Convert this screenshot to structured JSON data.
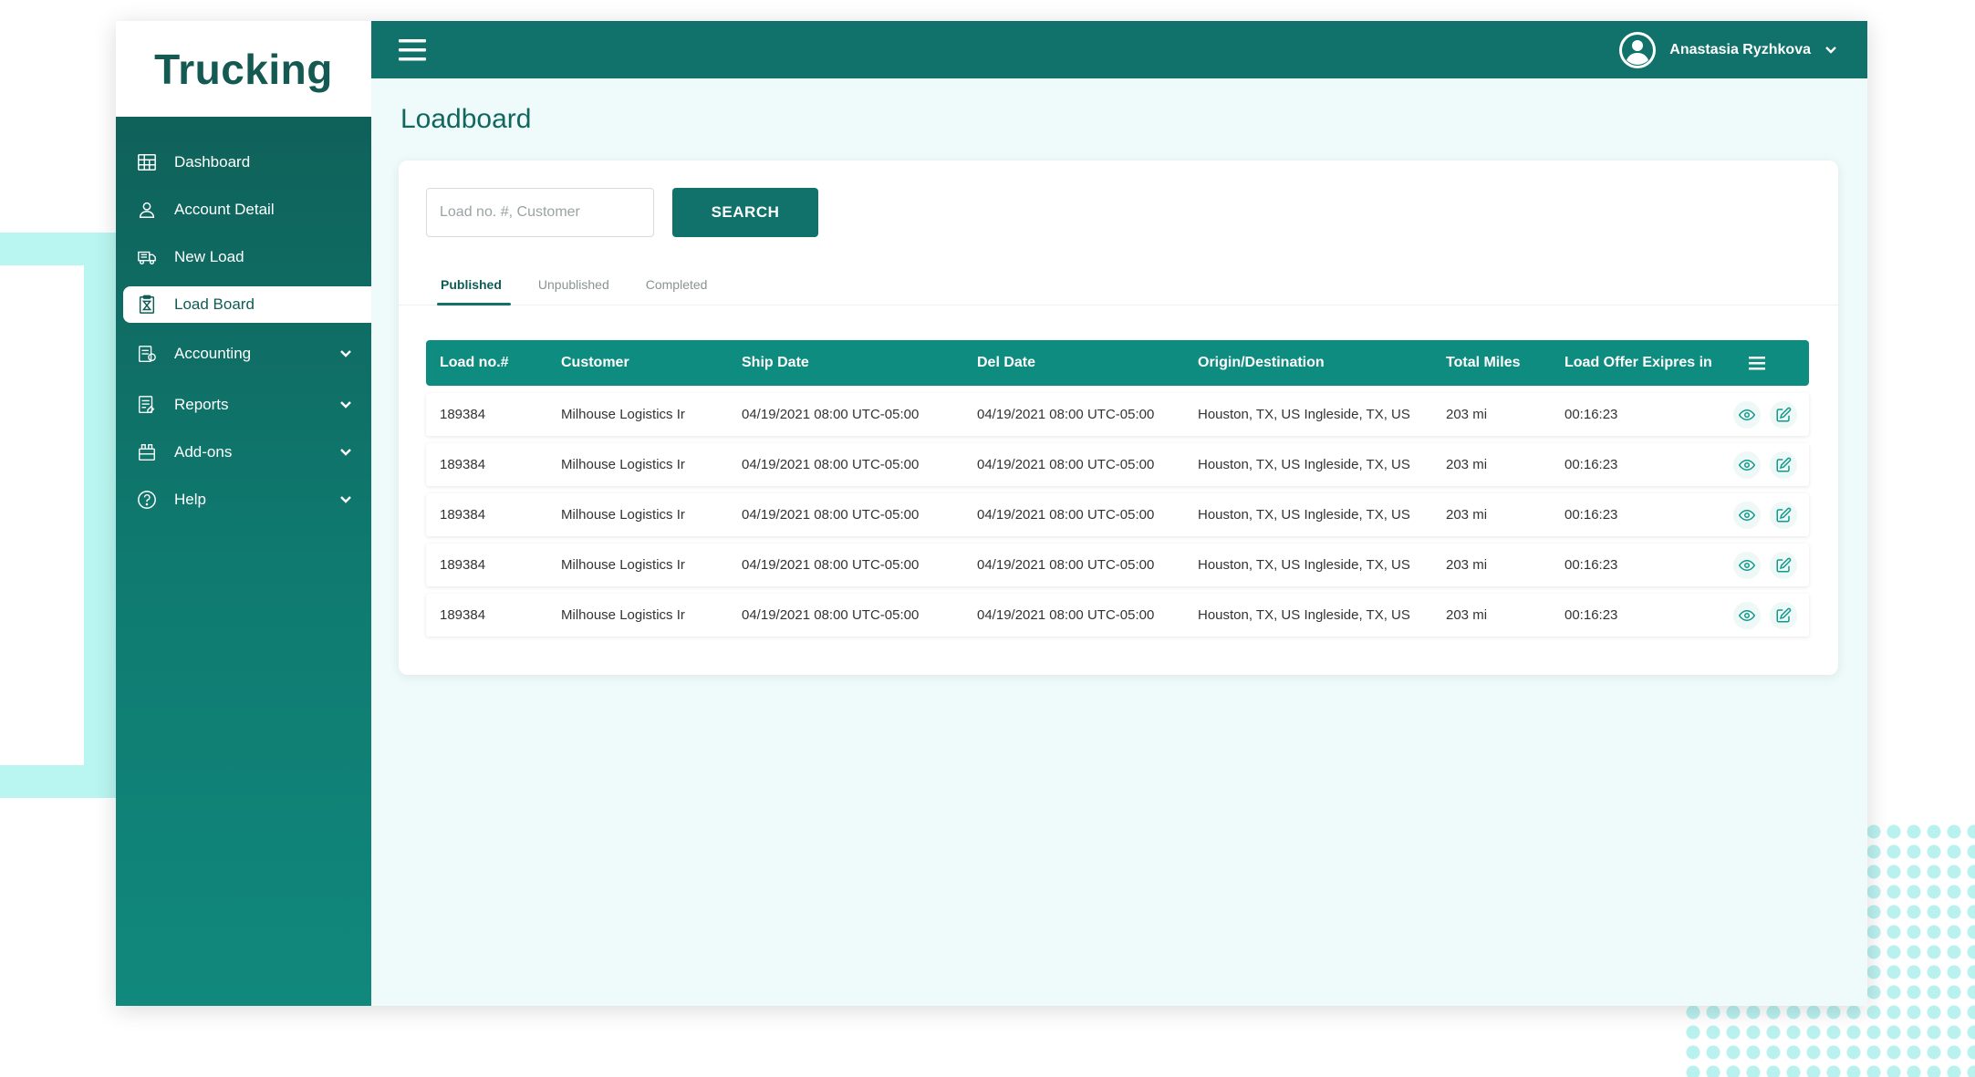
{
  "brand": {
    "name": "Trucking"
  },
  "sidebar": {
    "items": [
      {
        "label": "Dashboard",
        "icon": "dashboard-icon",
        "active": false
      },
      {
        "label": "Account Detail",
        "icon": "user-icon",
        "active": false
      },
      {
        "label": "New Load",
        "icon": "truck-icon",
        "active": false
      },
      {
        "label": "Load Board",
        "icon": "clipboard-icon",
        "active": true
      },
      {
        "label": "Accounting",
        "icon": "accounting-icon",
        "expandable": true
      },
      {
        "label": "Reports",
        "icon": "reports-icon",
        "expandable": true
      },
      {
        "label": "Add-ons",
        "icon": "addons-icon",
        "expandable": true
      },
      {
        "label": "Help",
        "icon": "help-icon",
        "expandable": true
      }
    ]
  },
  "header": {
    "user_name": "Anastasia Ryzhkova",
    "menu_icon": "hamburger-icon",
    "avatar_icon": "user-circle-icon"
  },
  "page": {
    "title": "Loadboard"
  },
  "search": {
    "placeholder": "Load no. #, Customer",
    "value": "",
    "button_label": "SEARCH"
  },
  "tabs": [
    {
      "label": "Published",
      "active": true
    },
    {
      "label": "Unpublished",
      "active": false
    },
    {
      "label": "Completed",
      "active": false
    }
  ],
  "table": {
    "columns": [
      "Load no.#",
      "Customer",
      "Ship Date",
      "Del Date",
      "Origin/Destination",
      "Total Miles",
      "Load Offer Exipres in"
    ],
    "rows": [
      [
        "189384",
        "Milhouse Logistics Ir",
        "04/19/2021 08:00 UTC-05:00",
        "04/19/2021 08:00 UTC-05:00",
        "Houston, TX, US Ingleside, TX, US",
        "203 mi",
        "00:16:23"
      ],
      [
        "189384",
        "Milhouse Logistics Ir",
        "04/19/2021 08:00 UTC-05:00",
        "04/19/2021 08:00 UTC-05:00",
        "Houston, TX, US Ingleside, TX, US",
        "203 mi",
        "00:16:23"
      ],
      [
        "189384",
        "Milhouse Logistics Ir",
        "04/19/2021 08:00 UTC-05:00",
        "04/19/2021 08:00 UTC-05:00",
        "Houston, TX, US Ingleside, TX, US",
        "203 mi",
        "00:16:23"
      ],
      [
        "189384",
        "Milhouse Logistics Ir",
        "04/19/2021 08:00 UTC-05:00",
        "04/19/2021 08:00 UTC-05:00",
        "Houston, TX, US Ingleside, TX, US",
        "203 mi",
        "00:16:23"
      ],
      [
        "189384",
        "Milhouse Logistics Ir",
        "04/19/2021 08:00 UTC-05:00",
        "04/19/2021 08:00 UTC-05:00",
        "Houston, TX, US Ingleside, TX, US",
        "203 mi",
        "00:16:23"
      ]
    ],
    "row_actions": [
      "eye-icon",
      "edit-icon"
    ]
  },
  "colors": {
    "primary": "#10726a",
    "table_header": "#0f8c80",
    "background": "#eefbfa",
    "accent_light": "#b9f6f1"
  }
}
